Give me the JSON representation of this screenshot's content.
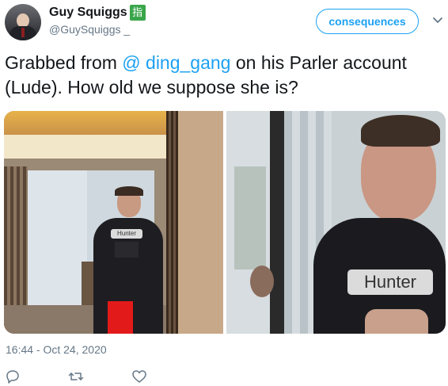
{
  "tweet": {
    "author": {
      "display_name": "Guy Squiggs",
      "badge_glyph": "指",
      "handle": "@GuySquiggs _",
      "avatar_icon": "avatar-man-in-suit"
    },
    "follow_button_label": "consequences",
    "text": {
      "before": "Grabbed from ",
      "mention": "@ ding_gang",
      "after": " on his Parler account (Lude). How old we suppose she is?"
    },
    "media": {
      "photo_left": {
        "tag_label": "Hunter"
      },
      "photo_right": {
        "tag_label": "Hunter"
      }
    },
    "timestamp": "16:44 - Oct 24, 2020",
    "actions": [
      "reply-icon",
      "retweet-icon",
      "like-icon"
    ]
  },
  "colors": {
    "accent": "#1da1f2",
    "badge": "#3aa64b",
    "secondary_text": "#657786"
  }
}
